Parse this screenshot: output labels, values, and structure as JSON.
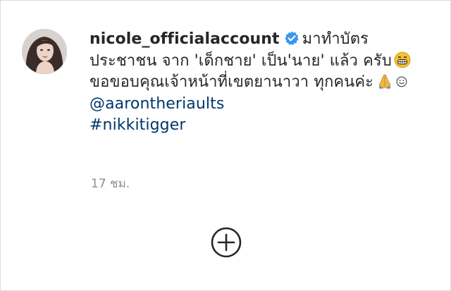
{
  "post": {
    "username": "nicole_officialaccount",
    "caption_line1": "มาทำบัตร",
    "caption_line2": "ประชาชน จาก 'เด็กชาย' เป็น'นาย' แล้ว",
    "caption_line3a": "ครับ",
    "caption_line3b": "ขอขอบคุณเจ้าหน้าที่เขตยานาวา",
    "caption_line4": "ทุกคนค่ะ",
    "mention": "@aarontheriaults",
    "hashtag": "#nikkitigger",
    "timestamp": "17 ชม."
  },
  "icons": {
    "verified": "verified-badge-icon",
    "grin_emoji": "grinning-face-emoji",
    "pray_emoji": "folded-hands-emoji",
    "smile_emoji": "smiling-face-emoji",
    "add_comment": "plus-circle-icon"
  },
  "colors": {
    "text": "#262626",
    "link": "#00376b",
    "muted": "#8e8e8e",
    "verified": "#3897f0"
  }
}
